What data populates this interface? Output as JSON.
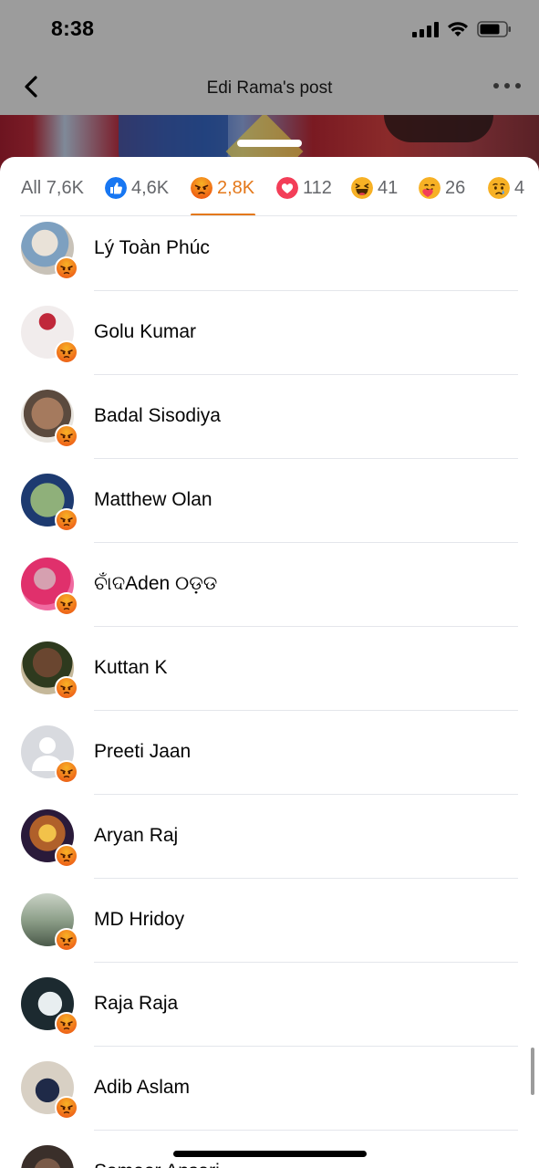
{
  "status": {
    "time": "8:38"
  },
  "nav": {
    "title": "Edi Rama's post"
  },
  "tabs": [
    {
      "label": "All 7,6K",
      "icon": "none"
    },
    {
      "label": "4,6K",
      "icon": "like-icon"
    },
    {
      "label": "2,8K",
      "icon": "angry-icon",
      "active": true
    },
    {
      "label": "112",
      "icon": "love-icon"
    },
    {
      "label": "41",
      "icon": "haha-icon"
    },
    {
      "label": "26",
      "icon": "care-icon"
    },
    {
      "label": "4",
      "icon": "sad-icon"
    }
  ],
  "reactors": [
    {
      "name": "Lý Toàn Phúc",
      "avatar": "photo"
    },
    {
      "name": "Golu Kumar",
      "avatar": "photo"
    },
    {
      "name": "Badal Sisodiya",
      "avatar": "photo"
    },
    {
      "name": "Matthew Olan",
      "avatar": "photo"
    },
    {
      "name": "ଚାଁଦAden ୦ଡ଼ଡ",
      "avatar": "photo"
    },
    {
      "name": "Kuttan K",
      "avatar": "photo"
    },
    {
      "name": "Preeti Jaan",
      "avatar": "default-silhouette"
    },
    {
      "name": "Aryan Raj",
      "avatar": "photo"
    },
    {
      "name": "MD Hridoy",
      "avatar": "photo"
    },
    {
      "name": "Raja Raja",
      "avatar": "photo"
    },
    {
      "name": "Adib Aslam",
      "avatar": "photo"
    },
    {
      "name": "Sameer Ansari",
      "avatar": "photo"
    }
  ],
  "colors": {
    "accent": "#e4781a",
    "like": "#1877f2",
    "love": "#f33e58"
  }
}
